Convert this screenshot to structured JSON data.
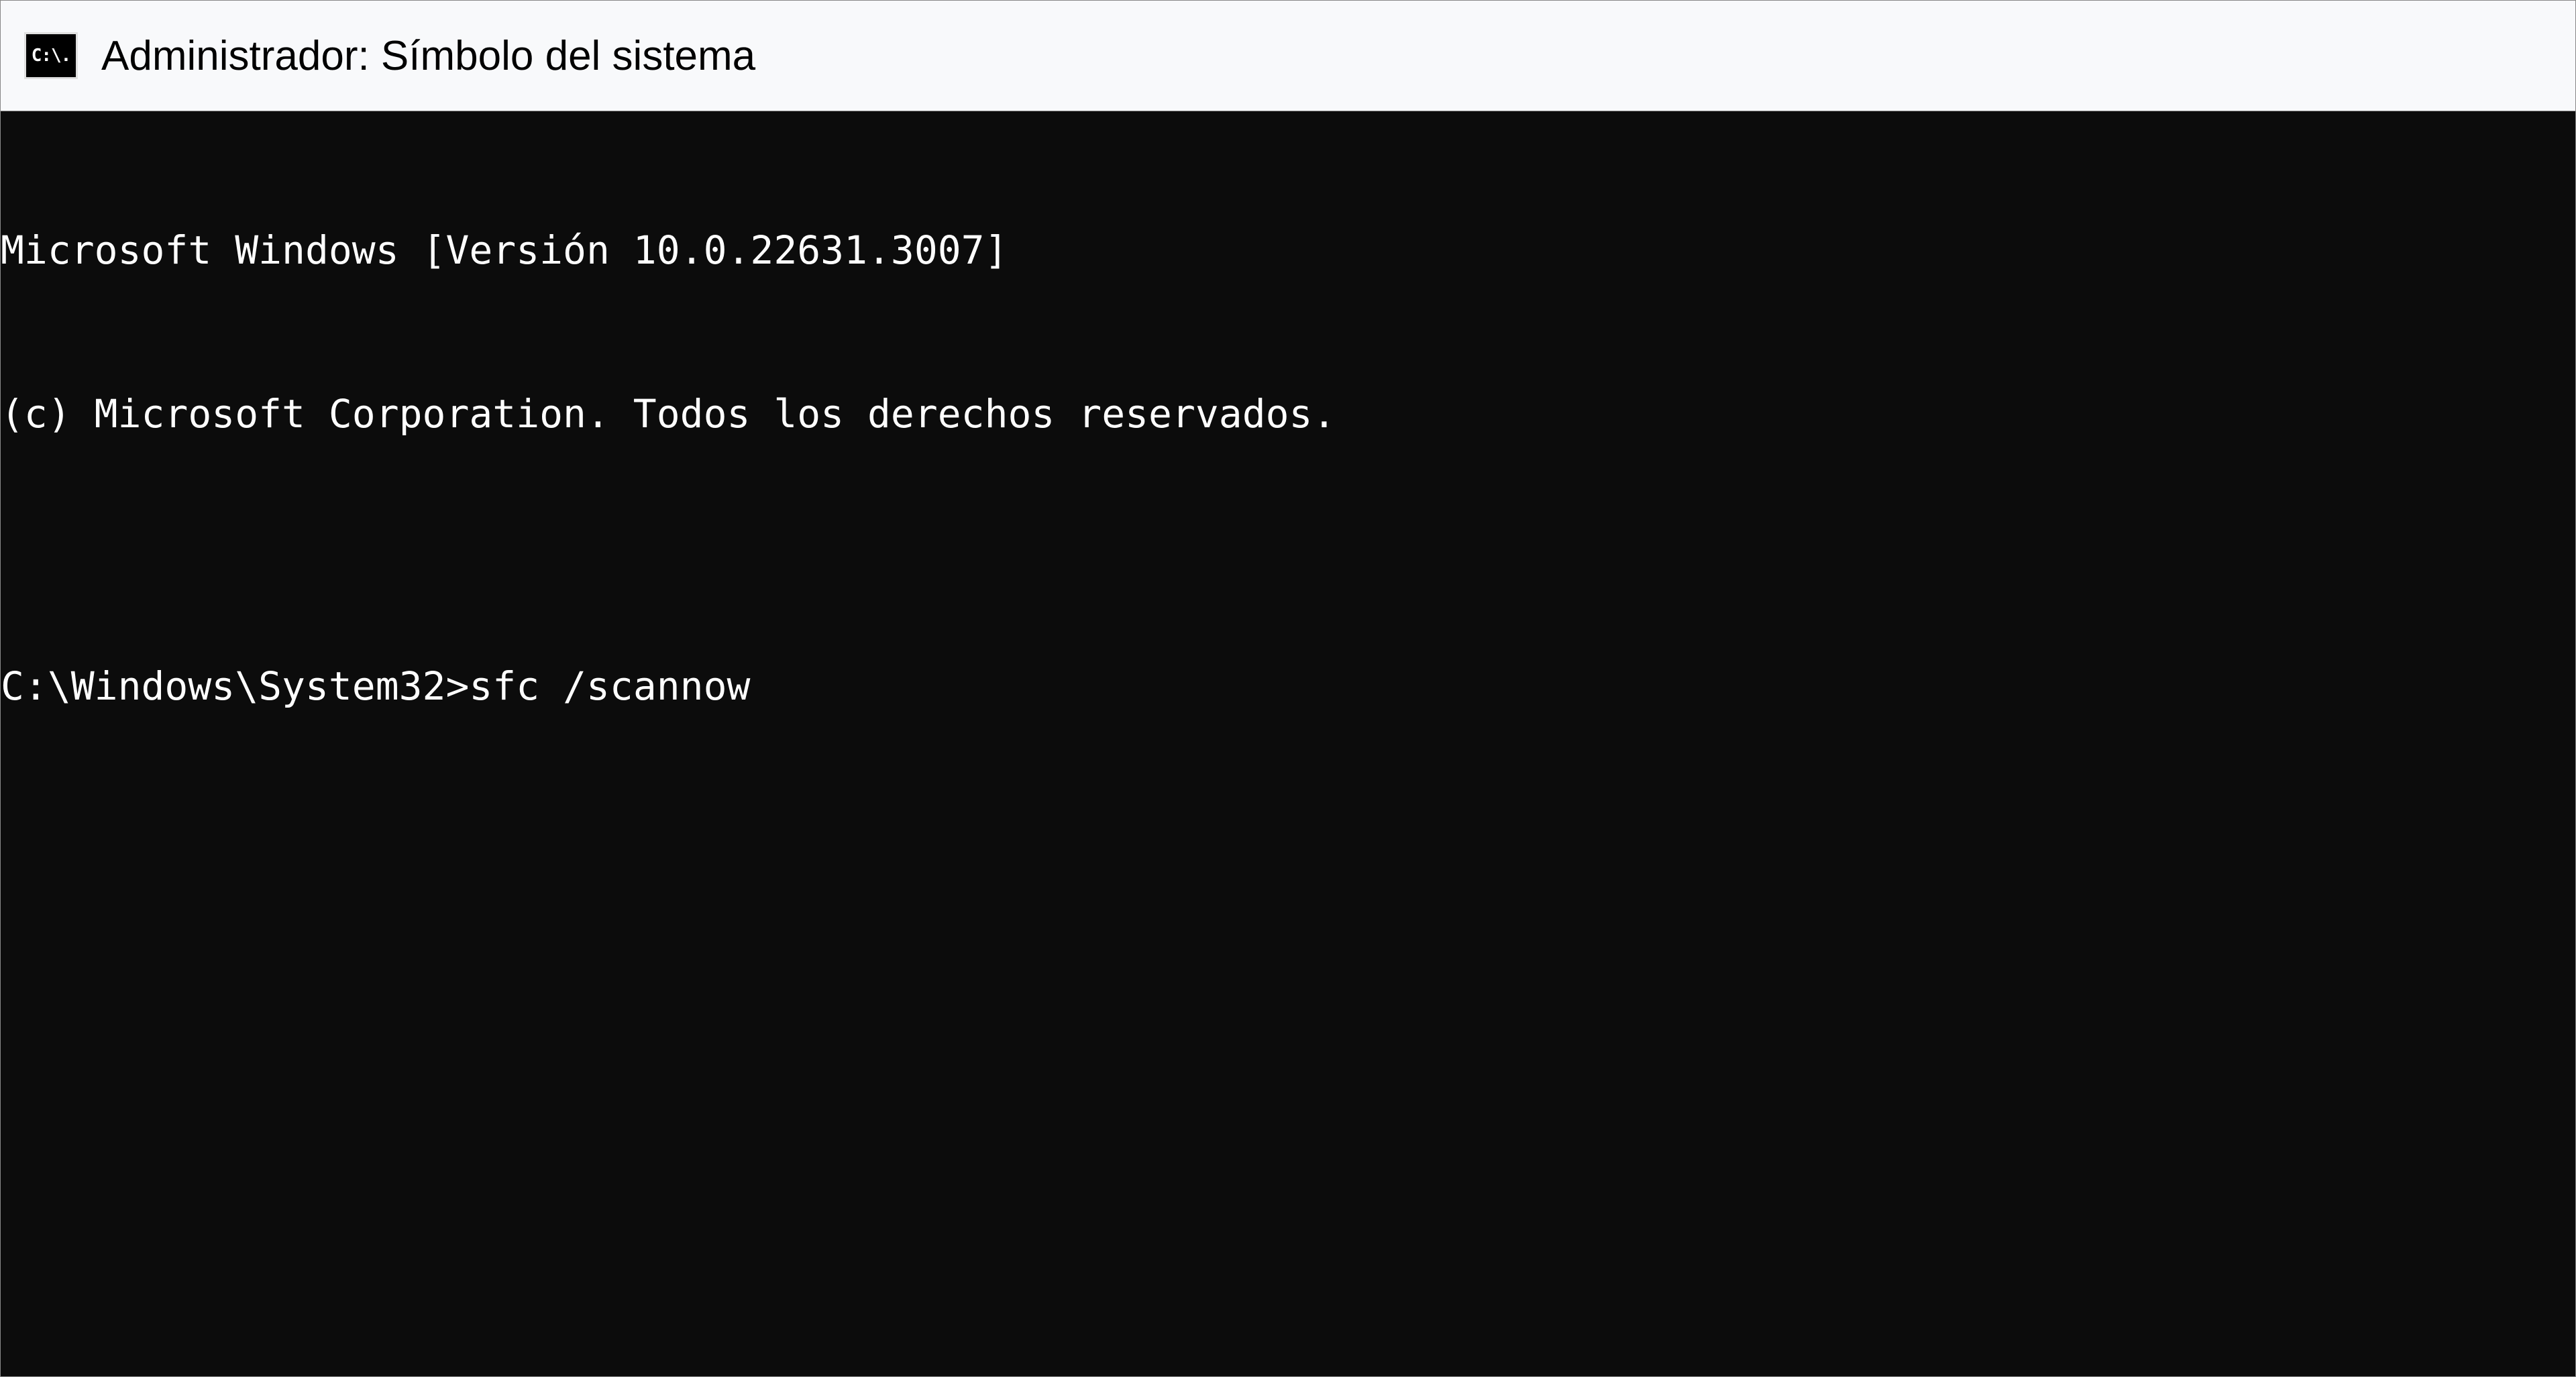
{
  "titlebar": {
    "icon_label": "C:\\.",
    "title": "Administrador: Símbolo del sistema"
  },
  "terminal": {
    "line1": "Microsoft Windows [Versión 10.0.22631.3007]",
    "line2": "(c) Microsoft Corporation. Todos los derechos reservados.",
    "blank": "",
    "prompt": "C:\\Windows\\System32>",
    "command": "sfc /scannow"
  }
}
